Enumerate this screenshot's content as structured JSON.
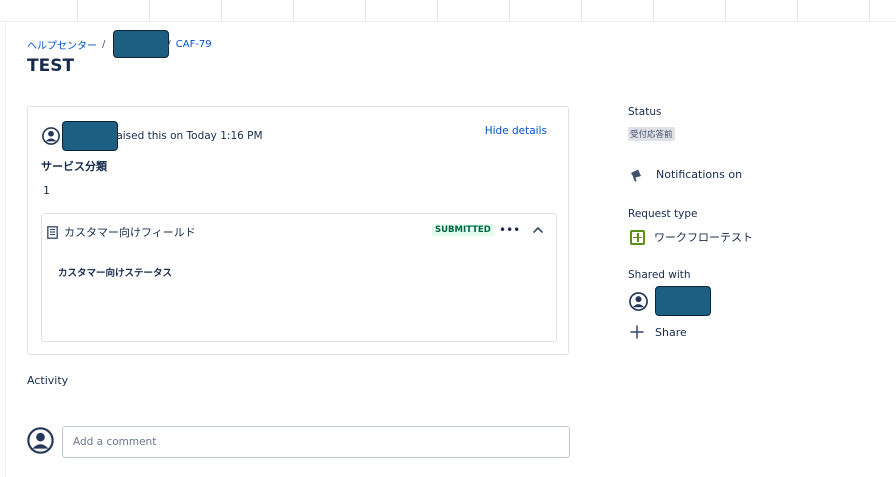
{
  "breadcrumb": {
    "home": "ヘルプセンター",
    "separator": "/",
    "issue_key": "CAF-79"
  },
  "page_title": "TEST",
  "request": {
    "raised_text": "raised this on Today 1:16 PM",
    "hide_details": "Hide details",
    "field_label": "サービス分類",
    "field_value": "1",
    "form": {
      "title": "カスタマー向けフィールド",
      "status_badge": "SUBMITTED",
      "more": "•••",
      "section_label": "カスタマー向けステータス"
    }
  },
  "activity": {
    "heading": "Activity",
    "comment_placeholder": "Add a comment"
  },
  "sidebar": {
    "status_label": "Status",
    "status_value": "受付応答前",
    "notifications": "Notifications on",
    "request_type_label": "Request type",
    "request_type_value": "ワークフローテスト",
    "shared_with_label": "Shared with",
    "share_button": "Share"
  },
  "colors": {
    "link": "#0052cc",
    "text": "#172b4d",
    "submitted_bg": "#e3fcef",
    "submitted_text": "#006644",
    "redaction": "#1d5f82",
    "request_type_icon": "#5b8f16"
  },
  "icons": {
    "avatar": "person-circle-icon",
    "form": "document-icon",
    "chevron": "chevron-up-icon",
    "notifications": "megaphone-icon",
    "request_type": "plus-square-icon",
    "share": "plus-icon"
  }
}
